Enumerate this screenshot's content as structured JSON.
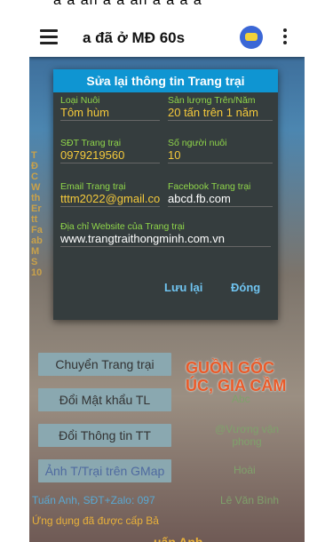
{
  "app": {
    "title": "a đã ở MĐ 60s"
  },
  "dialog": {
    "title": "Sửa lại thông tin Trang trại",
    "fields": [
      {
        "label": "Loại Nuôi",
        "value": "Tôm hùm"
      },
      {
        "label": "Sản lượng Trên/Năm",
        "value": "20 tấn trên 1 năm"
      },
      {
        "label": "SĐT Trang trại",
        "value": "0979219560"
      },
      {
        "label": "Số người nuôi",
        "value": "10"
      },
      {
        "label": "Email Trang trại",
        "value": "tttm2022@gmail.com"
      },
      {
        "label": "Facebook Trang trại",
        "value": "abcd.fb.com"
      },
      {
        "label": "Địa chỉ Website của Trang trại",
        "value": "www.trangtraithongminh.com.vn"
      }
    ],
    "save_label": "Lưu lại",
    "close_label": "Đóng"
  },
  "background": {
    "left_strip": [
      "T",
      "Đ",
      "C",
      "W",
      "th",
      "Er",
      "tt",
      "Fa",
      "ab",
      "M",
      "S",
      "10"
    ],
    "banner": [
      "GUỒN GỐC",
      "ÚC, GIA CẦM"
    ],
    "buttons": [
      "Chuyển Trang trại",
      "Đổi Mật khẩu TL",
      "Đổi Thông tin TT",
      "Ảnh T/Trại trên GMap"
    ],
    "right_items": [
      "Abc",
      "@Vương vận phong",
      "Hoài",
      "Lê Văn Bình"
    ],
    "ticker1": "Tuấn Anh, SĐT+Zalo: 097",
    "ticker2": "Ứng dụng đã được cấp Bả",
    "bottom_text": "uấn Anh"
  },
  "colors": {
    "appbar": "#ffffff",
    "dialog_header": "#0f95d2",
    "label_green": "#8fd54a",
    "value_yellow": "#f4c93b",
    "button_blue": "#6fc3ef"
  }
}
